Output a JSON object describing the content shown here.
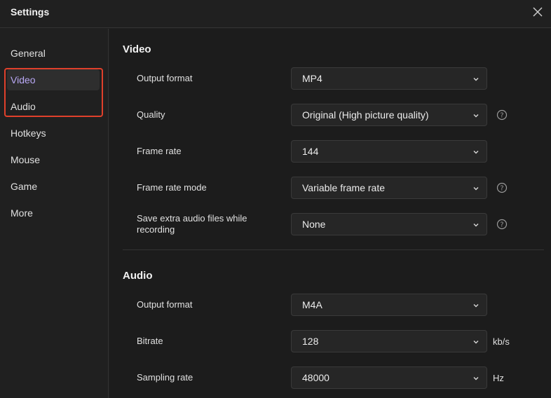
{
  "window": {
    "title": "Settings"
  },
  "sidebar": {
    "items": [
      {
        "label": "General"
      },
      {
        "label": "Video"
      },
      {
        "label": "Audio"
      },
      {
        "label": "Hotkeys"
      },
      {
        "label": "Mouse"
      },
      {
        "label": "Game"
      },
      {
        "label": "More"
      }
    ],
    "active": "Video"
  },
  "video": {
    "title": "Video",
    "output_format": {
      "label": "Output format",
      "value": "MP4"
    },
    "quality": {
      "label": "Quality",
      "value": "Original (High picture quality)"
    },
    "frame_rate": {
      "label": "Frame rate",
      "value": "144"
    },
    "frame_rate_mode": {
      "label": "Frame rate mode",
      "value": "Variable frame rate"
    },
    "extra_audio": {
      "label": "Save extra audio files while recording",
      "value": "None"
    }
  },
  "audio": {
    "title": "Audio",
    "output_format": {
      "label": "Output format",
      "value": "M4A"
    },
    "bitrate": {
      "label": "Bitrate",
      "value": "128",
      "unit": "kb/s"
    },
    "sampling_rate": {
      "label": "Sampling rate",
      "value": "48000",
      "unit": "Hz"
    }
  },
  "colors": {
    "accent": "#b9a8f5",
    "highlight": "#e0402b"
  },
  "icons": {
    "close": "close-icon",
    "dropdown": "chevron-down-icon",
    "help": "help-circle-icon"
  }
}
